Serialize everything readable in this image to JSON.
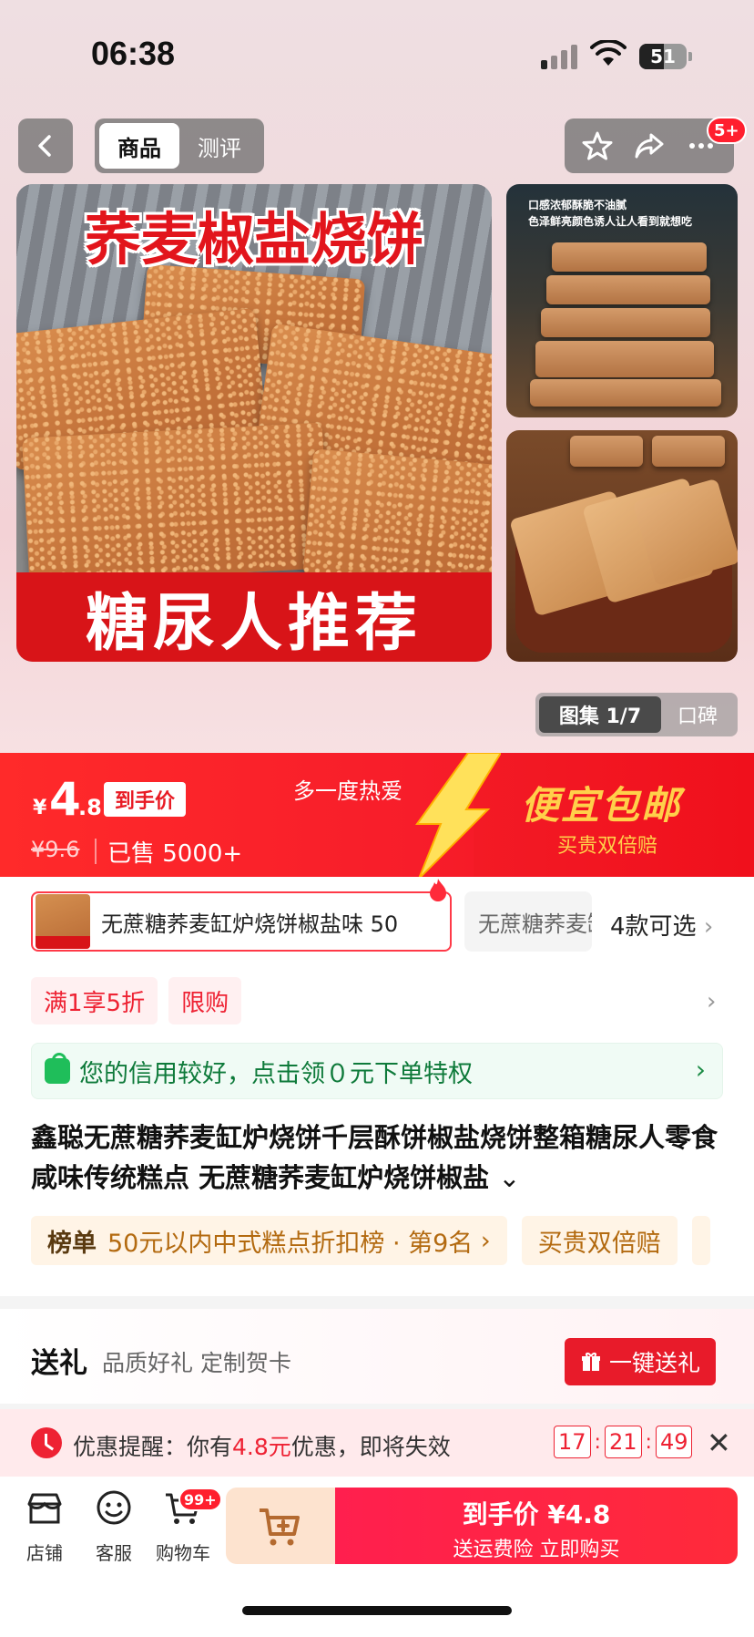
{
  "status": {
    "time": "06:38",
    "battery": "51",
    "battery_level": 0.51
  },
  "nav": {
    "tabs": [
      {
        "label": "商品",
        "active": true
      },
      {
        "label": "测评",
        "active": false
      }
    ],
    "message_badge": "5+",
    "icons": [
      "back-icon",
      "star-icon",
      "share-icon",
      "more-icon"
    ]
  },
  "images": {
    "main_title": "荞麦椒盐烧饼",
    "main_banner": "糖尿人推荐",
    "side1_caption": "口感浓郁酥脆不油腻\n色泽鲜亮颜色诱人让人看到就想吃",
    "gallery_label": "图集 1/7",
    "reviews_label": "口碑"
  },
  "price": {
    "currency": "¥",
    "integer": "4",
    "decimal": ".8",
    "price_tag": "到手价",
    "original": "¥9.6",
    "sold": "已售 5000+",
    "slogan_left": "多一度热爱",
    "slogan": "便宜包邮",
    "slogan_sub": "买贵双倍赔"
  },
  "sku": {
    "selected": "无蔗糖荞麦缸炉烧饼椒盐味 50",
    "other": "无蔗糖荞麦缸炉烧饼",
    "more": "4款可选"
  },
  "promos": [
    "满1享5折",
    "限购"
  ],
  "credit": {
    "text": "您的信用较好，点击领０元下单特权"
  },
  "product_title": "鑫聪无蔗糖荞麦缸炉烧饼千层酥饼椒盐烧饼整箱糖尿人零食咸味传统糕点 无蔗糖荞麦缸炉烧饼椒盐",
  "rank": {
    "prefix": "榜单",
    "text": "50元以内中式糕点折扣榜 · 第9名",
    "guarantee": "买贵双倍赔"
  },
  "gift": {
    "title": "送礼",
    "subtitle": "品质好礼 定制贺卡",
    "button": "一键送礼"
  },
  "notice": {
    "prefix": "优惠提醒：你有",
    "amount": "4.8元",
    "suffix": "优惠，即将失效",
    "hours": "17",
    "minutes": "21",
    "seconds": "49"
  },
  "bottom": {
    "tabs": [
      {
        "label": "店铺",
        "icon": "store-icon"
      },
      {
        "label": "客服",
        "icon": "service-icon"
      },
      {
        "label": "购物车",
        "icon": "cart-icon"
      }
    ],
    "cart_badge": "99+",
    "buy_line1": "到手价 ¥4.8",
    "buy_line2": "送运费险 立即购买"
  },
  "colors": {
    "accent": "#ee2233",
    "brand_red": "#f71d2a",
    "gold": "#ffd04a",
    "green": "#1fbe5a"
  }
}
